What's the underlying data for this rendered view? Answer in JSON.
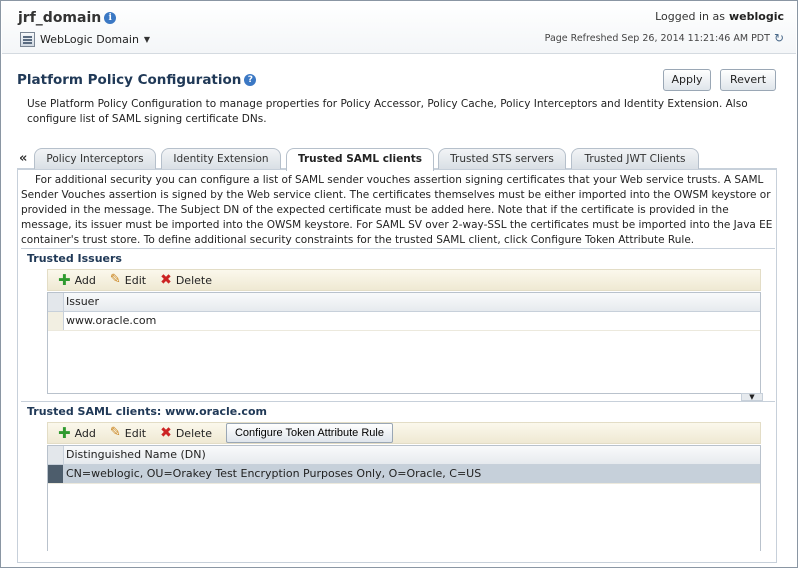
{
  "header": {
    "domain_name": "jrf_domain",
    "domain_menu": "WebLogic Domain",
    "logged_in_label": "Logged in as",
    "username": "weblogic",
    "refreshed": "Page Refreshed Sep 26, 2014 11:21:46 AM PDT"
  },
  "page": {
    "title": "Platform Policy Configuration",
    "apply_label": "Apply",
    "revert_label": "Revert",
    "intro": "Use Platform Policy Configuration to manage properties for Policy Accessor, Policy Cache, Policy Interceptors and Identity Extension. Also configure list of SAML signing certificate DNs."
  },
  "tabs": [
    {
      "label": "Policy Interceptors",
      "active": false
    },
    {
      "label": "Identity Extension",
      "active": false
    },
    {
      "label": "Trusted SAML clients",
      "active": true
    },
    {
      "label": "Trusted STS servers",
      "active": false
    },
    {
      "label": "Trusted JWT Clients",
      "active": false
    }
  ],
  "tab_collapse_glyph": "«",
  "description": "For additional security you can configure a list of SAML sender vouches assertion signing certificates that your Web service trusts. A SAML Sender Vouches assertion is signed by the Web service client. The certificates themselves must be either imported into the OWSM keystore or provided in the message. The Subject DN of the expected certificate must be added here. Note that if the certificate is provided in the message, its issuer must be imported into the OWSM keystore. For SAML SV over 2-way-SSL the certificates must be imported into the Java EE container's trust store. To define additional security constraints for the trusted SAML client, click Configure Token Attribute Rule.",
  "issuers": {
    "title": "Trusted Issuers",
    "toolbar": {
      "add": "Add",
      "edit": "Edit",
      "delete": "Delete"
    },
    "column": "Issuer",
    "rows": [
      "www.oracle.com"
    ]
  },
  "clients": {
    "title": "Trusted SAML clients: www.oracle.com",
    "toolbar": {
      "add": "Add",
      "edit": "Edit",
      "delete": "Delete",
      "configure": "Configure Token Attribute Rule"
    },
    "column": "Distinguished Name (DN)",
    "rows": [
      "CN=weblogic, OU=Orakey Test Encryption Purposes Only, O=Oracle, C=US"
    ]
  },
  "colors": {
    "accent": "#203957",
    "toolbar": "#efe9d3",
    "selected_row": "#c6d0da"
  }
}
